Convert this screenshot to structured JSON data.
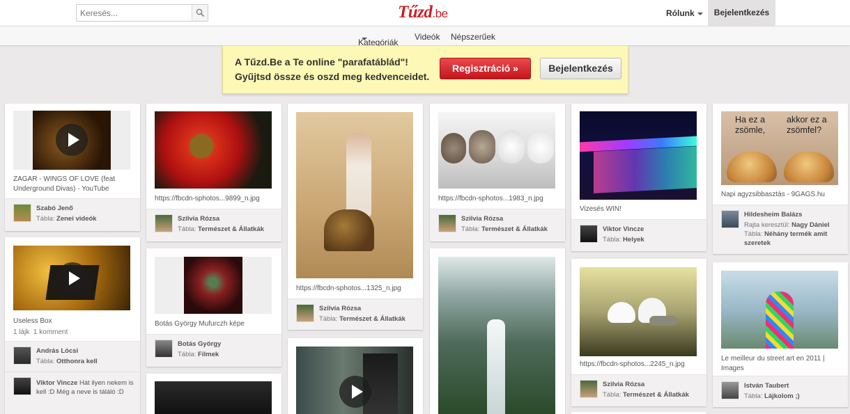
{
  "header": {
    "search_placeholder": "Keresés...",
    "logo_main": "Tűzd",
    "logo_tld": ".be",
    "about_label": "Rólunk",
    "login_label": "Bejelentkezés"
  },
  "subnav": {
    "categories": "Kategóriák",
    "videos": "Videók",
    "popular": "Népszerűek"
  },
  "banner": {
    "line1": "A Tűzd.Be a Te online \"parafatáblád\"!",
    "line2": "Gyűjtsd össze és oszd meg kedvenceidet.",
    "register": "Regisztráció »",
    "login": "Bejelentkezés"
  },
  "pins": {
    "p1": {
      "desc": "ZAGAR - WINGS OF LOVE (feat Underground Divas) - YouTube",
      "user": "Szabó Jenő",
      "board_prefix": "Tábla:",
      "board": "Zenei videók"
    },
    "p2": {
      "desc": "Useless Box",
      "likes": "1 lájk",
      "comments": "1 komment",
      "user": "András Lócsi",
      "board_prefix": "Tábla:",
      "board": "Otthonra kell",
      "comment_user": "Viktor Vincze",
      "comment_text": "Hát ilyen nekem is kell :D Még a neve is táláló :D"
    },
    "p3": {
      "desc": "https://fbcdn-sphotos...9899_n.jpg",
      "user": "Szilvia Rózsa",
      "board_prefix": "Tábla:",
      "board": "Természet & Állatkák"
    },
    "p4": {
      "desc": "Botás György Mufurczh képe",
      "user": "Botás György",
      "board_prefix": "Tábla:",
      "board": "Filmek"
    },
    "p5": {
      "desc": "https://fbcdn-sphotos...1325_n.jpg",
      "user": "Szilvia Rózsa",
      "board_prefix": "Tábla:",
      "board": "Természet & Állatkák"
    },
    "p6": {
      "desc": "https://fbcdn-sphotos...1983_n.jpg",
      "user": "Szilvia Rózsa",
      "board_prefix": "Tábla:",
      "board": "Természet & Állatkák"
    },
    "p7": {
      "desc": "Vizesés WIN!",
      "user": "Viktor Vincze",
      "board_prefix": "Tábla:",
      "board": "Helyek"
    },
    "p8": {
      "desc": "https://fbcdn-sphotos...2245_n.jpg",
      "user": "Szilvia Rózsa",
      "board_prefix": "Tábla:",
      "board": "Természet & Állatkák"
    },
    "p9": {
      "img_text_left": "Ha ez a zsömle,",
      "img_text_right": "akkor ez a zsömfel?",
      "desc": "Napi agyzsibbasztás - 9GAGS.hu",
      "user": "Hildesheim Balázs",
      "via_prefix": "Rajta keresztül:",
      "via": "Nagy Dániel",
      "board_prefix": "Tábla:",
      "board": "Néhány termék amit szeretek"
    },
    "p10": {
      "desc": "Le meilleur du street art en 2011 | Images",
      "user": "István Taubert",
      "board_prefix": "Tábla:",
      "board": "Lájkolom ;)"
    }
  },
  "colors": {
    "brand": "#cb2027",
    "banner_bg": "#fdf8b5",
    "register_btn": "#d8262c"
  }
}
